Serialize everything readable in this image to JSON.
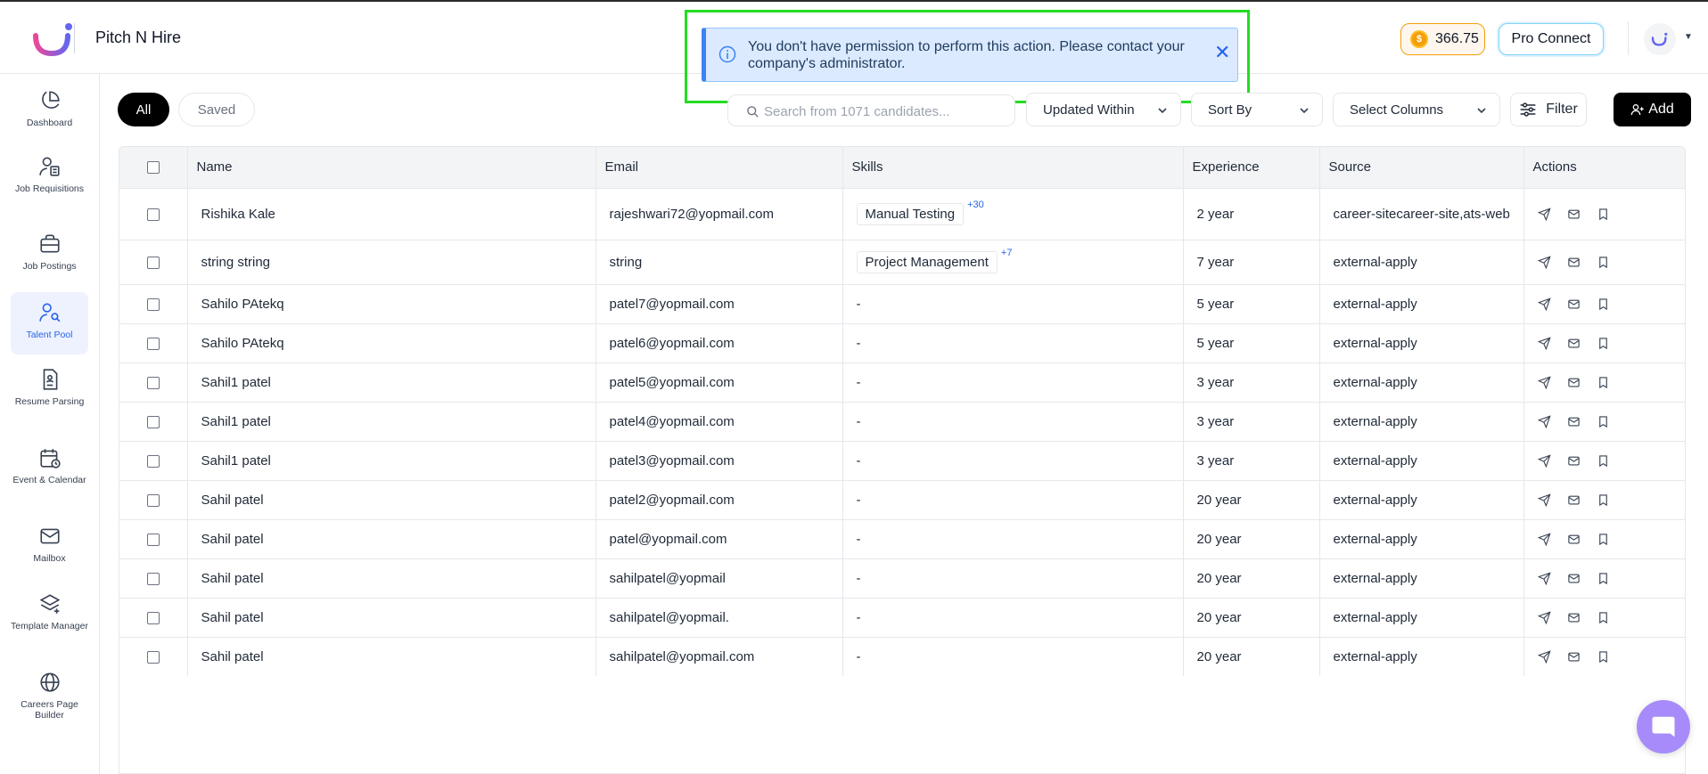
{
  "app": {
    "name": "Pitch N Hire"
  },
  "header": {
    "coins": "366.75",
    "pro_connect_label": "Pro Connect"
  },
  "toast": {
    "message": "You don't have permission to perform this action. Please contact your company's administrator."
  },
  "sidebar": {
    "items": [
      {
        "label": "Dashboard",
        "icon": "pie-chart-icon",
        "active": false
      },
      {
        "label": "Job Requisitions",
        "icon": "user-clipboard-icon",
        "active": false
      },
      {
        "label": "Job Postings",
        "icon": "briefcase-icon",
        "active": false
      },
      {
        "label": "Talent Pool",
        "icon": "user-search-icon",
        "active": true
      },
      {
        "label": "Resume Parsing",
        "icon": "document-icon",
        "active": false
      },
      {
        "label": "Event & Calendar",
        "icon": "calendar-icon",
        "active": false
      },
      {
        "label": "Mailbox",
        "icon": "mail-icon",
        "active": false
      },
      {
        "label": "Template Manager",
        "icon": "layers-icon",
        "active": false
      },
      {
        "label": "Careers Page Builder",
        "icon": "globe-icon",
        "active": false
      }
    ]
  },
  "tabs": {
    "all": "All",
    "saved": "Saved"
  },
  "toolbar": {
    "search_placeholder": "Search from 1071 candidates...",
    "updated_within": "Updated Within",
    "sort_by": "Sort By",
    "select_columns": "Select Columns",
    "filter_label": "Filter",
    "add_label": "Add"
  },
  "table": {
    "columns": [
      "Name",
      "Email",
      "Skills",
      "Experience",
      "Source",
      "Actions"
    ],
    "rows": [
      {
        "name": "Rishika Kale",
        "email": "rajeshwari72@yopmail.com",
        "skill": "Manual Testing",
        "skill_more": "+30",
        "experience": "2 year",
        "source": "career-sitecareer-site,ats-web"
      },
      {
        "name": "string string",
        "email": "string",
        "skill": "Project Management",
        "skill_more": "+7",
        "experience": "7 year",
        "source": "external-apply"
      },
      {
        "name": "Sahilo PAtekq",
        "email": "patel7@yopmail.com",
        "skill": "-",
        "skill_more": "",
        "experience": "5 year",
        "source": "external-apply"
      },
      {
        "name": "Sahilo PAtekq",
        "email": "patel6@yopmail.com",
        "skill": "-",
        "skill_more": "",
        "experience": "5 year",
        "source": "external-apply"
      },
      {
        "name": "Sahil1 patel",
        "email": "patel5@yopmail.com",
        "skill": "-",
        "skill_more": "",
        "experience": "3 year",
        "source": "external-apply"
      },
      {
        "name": "Sahil1 patel",
        "email": "patel4@yopmail.com",
        "skill": "-",
        "skill_more": "",
        "experience": "3 year",
        "source": "external-apply"
      },
      {
        "name": "Sahil1 patel",
        "email": "patel3@yopmail.com",
        "skill": "-",
        "skill_more": "",
        "experience": "3 year",
        "source": "external-apply"
      },
      {
        "name": "Sahil patel",
        "email": "patel2@yopmail.com",
        "skill": "-",
        "skill_more": "",
        "experience": "20 year",
        "source": "external-apply"
      },
      {
        "name": "Sahil patel",
        "email": "patel@yopmail.com",
        "skill": "-",
        "skill_more": "",
        "experience": "20 year",
        "source": "external-apply"
      },
      {
        "name": "Sahil patel",
        "email": "sahilpatel@yopmail",
        "skill": "-",
        "skill_more": "",
        "experience": "20 year",
        "source": "external-apply"
      },
      {
        "name": "Sahil patel",
        "email": "sahilpatel@yopmail.",
        "skill": "-",
        "skill_more": "",
        "experience": "20 year",
        "source": "external-apply"
      },
      {
        "name": "Sahil patel",
        "email": "sahilpatel@yopmail.com",
        "skill": "-",
        "skill_more": "",
        "experience": "20 year",
        "source": "external-apply"
      }
    ]
  },
  "colors": {
    "accent": "#2563eb",
    "toast_bg": "#dbeafe",
    "highlight": "#22dd22",
    "chat": "#a78bfa"
  }
}
